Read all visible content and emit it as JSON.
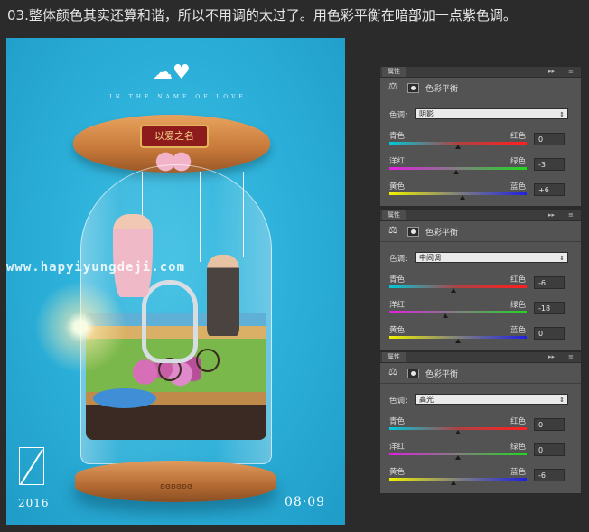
{
  "heading": "03.整体颜色其实还算和谐，所以不用调的太过了。用色彩平衡在暗部加一点紫色调。",
  "poster": {
    "arc_text": "IN THE NAME OF LOVE",
    "plaque_text": "以爱之名",
    "watermark": "www.hapyiyungdeji.com",
    "year": "2016",
    "date": "08·09",
    "base_logo": "ʚɞʚɞʚɞ"
  },
  "panels": [
    {
      "tab_label": "属性",
      "title": "色彩平衡",
      "tone_label": "色调:",
      "tone_value": "阴影",
      "sliders": [
        {
          "left": "青色",
          "right": "红色",
          "value": "0",
          "level": 0
        },
        {
          "left": "洋红",
          "right": "绿色",
          "value": "-3",
          "level": -3
        },
        {
          "left": "黄色",
          "right": "蓝色",
          "value": "+6",
          "level": 6
        }
      ]
    },
    {
      "tab_label": "属性",
      "title": "色彩平衡",
      "tone_label": "色调:",
      "tone_value": "中间调",
      "sliders": [
        {
          "left": "青色",
          "right": "红色",
          "value": "-6",
          "level": -6
        },
        {
          "left": "洋红",
          "right": "绿色",
          "value": "-18",
          "level": -18
        },
        {
          "left": "黄色",
          "right": "蓝色",
          "value": "0",
          "level": 0
        }
      ]
    },
    {
      "tab_label": "属性",
      "title": "色彩平衡",
      "tone_label": "色调:",
      "tone_value": "高光",
      "sliders": [
        {
          "left": "青色",
          "right": "红色",
          "value": "0",
          "level": 0
        },
        {
          "left": "洋红",
          "right": "绿色",
          "value": "0",
          "level": 0
        },
        {
          "left": "黄色",
          "right": "蓝色",
          "value": "-6",
          "level": -6
        }
      ]
    }
  ],
  "icons": {
    "panel_icon": "balance-scale-icon",
    "mask_icon": "layer-mask-icon"
  }
}
